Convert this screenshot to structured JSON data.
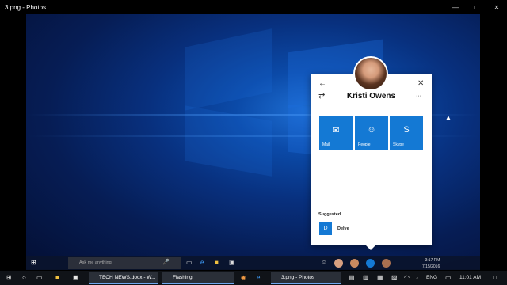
{
  "window": {
    "title": "3.png - Photos",
    "minimize": "—",
    "maximize": "□",
    "close": "✕"
  },
  "card": {
    "name": "Kristi Owens",
    "back": "←",
    "close": "✕",
    "swap": "⇄",
    "more": "···",
    "apps": [
      {
        "label": "Mail",
        "glyph": "✉"
      },
      {
        "label": "People",
        "glyph": "☺"
      },
      {
        "label": "Skype",
        "glyph": "S"
      }
    ],
    "suggested_heading": "Suggested",
    "suggested": [
      {
        "label": "Delve",
        "glyph": "D"
      }
    ]
  },
  "inner_taskbar": {
    "search_placeholder": "Ask me anything",
    "time": "3:17 PM",
    "date": "7/15/2016"
  },
  "taskbar": {
    "tasks": [
      "TECH NEWS.docx - W...",
      "Flashing",
      "3.png - Photos"
    ],
    "language": "ENG",
    "time": "11:01 AM"
  },
  "colors": {
    "accent": "#1479d4",
    "desktop": "#0b4aa8",
    "taskbar": "#101318"
  }
}
